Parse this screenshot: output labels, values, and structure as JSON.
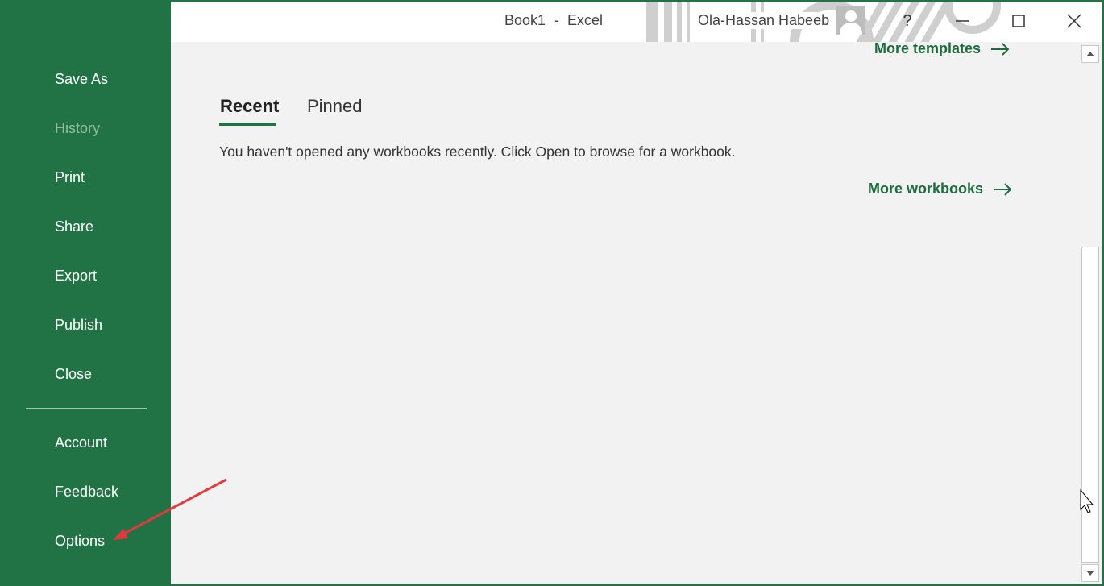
{
  "window": {
    "doc_title": "Book1",
    "separator": "-",
    "app_name": "Excel",
    "user_name": "Ola-Hassan Habeeb"
  },
  "window_controls": {
    "help": "?"
  },
  "sidebar": {
    "items": [
      {
        "label": "Save As"
      },
      {
        "label": "History"
      },
      {
        "label": "Print"
      },
      {
        "label": "Share"
      },
      {
        "label": "Export"
      },
      {
        "label": "Publish"
      },
      {
        "label": "Close"
      },
      {
        "label": "Account"
      },
      {
        "label": "Feedback"
      },
      {
        "label": "Options"
      }
    ]
  },
  "main": {
    "more_templates": "More templates",
    "tabs": [
      {
        "label": "Recent",
        "active": true
      },
      {
        "label": "Pinned",
        "active": false
      }
    ],
    "empty_message": "You haven't opened any workbooks recently. Click Open to browse for a workbook.",
    "more_workbooks": "More workbooks"
  },
  "icons": [
    "user-avatar-icon",
    "help-icon",
    "minimize-icon",
    "maximize-icon",
    "close-icon",
    "arrow-right-icon",
    "scroll-up-icon",
    "scroll-down-icon",
    "mouse-cursor-icon"
  ],
  "colors": {
    "accent": "#217346",
    "link": "#1d6b3f",
    "annotation_arrow": "#e0393e"
  }
}
